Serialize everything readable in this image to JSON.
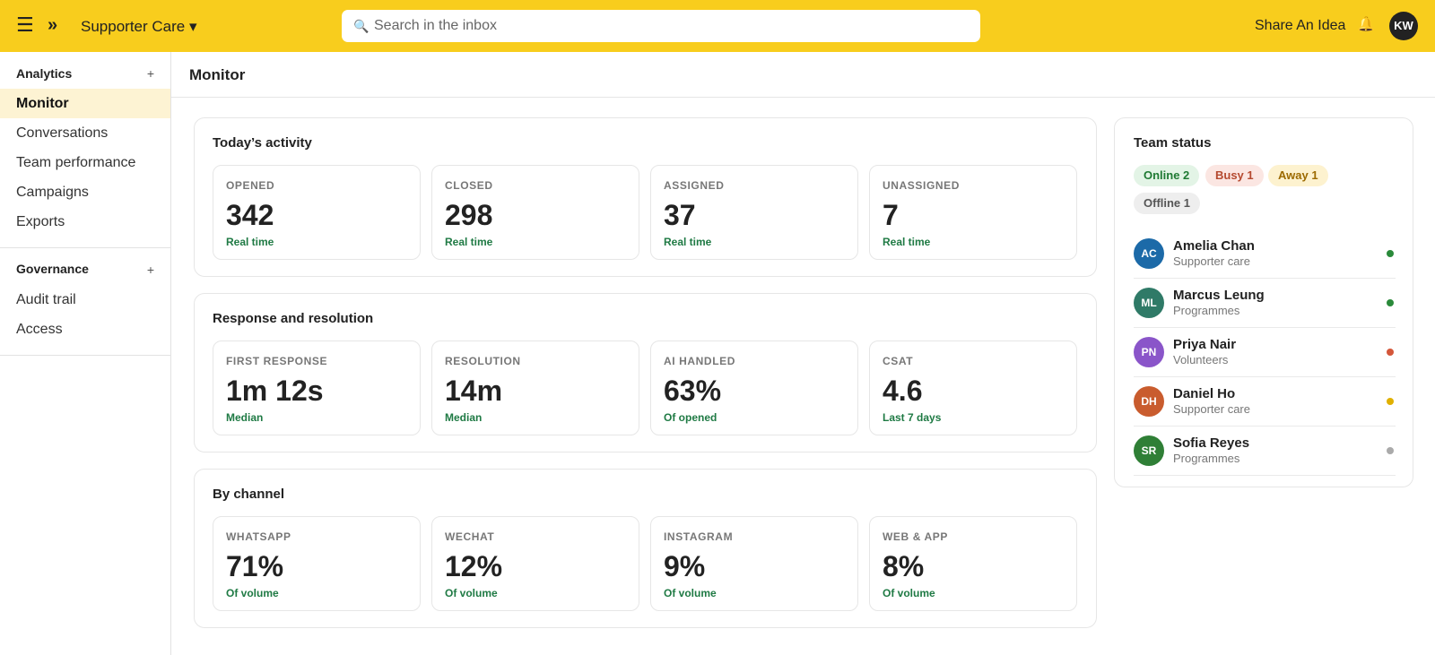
{
  "topbar": {
    "workspace": "Supporter Care ▾",
    "search_placeholder": "Search in the inbox",
    "share_label": "Share An Idea",
    "user_initials": "KW"
  },
  "sidebar": {
    "sections": [
      {
        "title": "Analytics",
        "items": [
          "Monitor",
          "Conversations",
          "Team performance",
          "Campaigns",
          "Exports"
        ]
      },
      {
        "title": "Governance",
        "items": [
          "Audit trail",
          "Access"
        ]
      }
    ],
    "active": "Monitor"
  },
  "page": {
    "title": "Monitor"
  },
  "activity": {
    "title": "Today’s activity",
    "cards": [
      {
        "label": "OPENED",
        "value": "342",
        "sub": "Real time"
      },
      {
        "label": "CLOSED",
        "value": "298",
        "sub": "Real time"
      },
      {
        "label": "ASSIGNED",
        "value": "37",
        "sub": "Real time"
      },
      {
        "label": "UNASSIGNED",
        "value": "7",
        "sub": "Real time"
      }
    ]
  },
  "response": {
    "title": "Response and resolution",
    "cards": [
      {
        "label": "FIRST RESPONSE",
        "value": "1m 12s",
        "sub": "Median"
      },
      {
        "label": "RESOLUTION",
        "value": "14m",
        "sub": "Median"
      },
      {
        "label": "AI HANDLED",
        "value": "63%",
        "sub": "Of opened"
      },
      {
        "label": "CSAT",
        "value": "4.6",
        "sub": "Last 7 days"
      }
    ]
  },
  "channels": {
    "title": "By channel",
    "cards": [
      {
        "label": "WHATSAPP",
        "value": "71%",
        "sub": "Of volume"
      },
      {
        "label": "WECHAT",
        "value": "12%",
        "sub": "Of volume"
      },
      {
        "label": "INSTAGRAM",
        "value": "9%",
        "sub": "Of volume"
      },
      {
        "label": "WEB & APP",
        "value": "8%",
        "sub": "Of volume"
      }
    ]
  },
  "team": {
    "title": "Team status",
    "chips": {
      "online": "Online 2",
      "busy": "Busy 1",
      "away": "Away 1",
      "offline": "Offline 1"
    },
    "members": [
      {
        "initials": "AC",
        "name": "Amelia Chan",
        "role": "Supporter care",
        "status": "online",
        "color": "#1c6aa8"
      },
      {
        "initials": "ML",
        "name": "Marcus Leung",
        "role": "Programmes",
        "status": "online",
        "color": "#2f7a67"
      },
      {
        "initials": "PN",
        "name": "Priya Nair",
        "role": "Volunteers",
        "status": "busy",
        "color": "#8a55c9"
      },
      {
        "initials": "DH",
        "name": "Daniel Ho",
        "role": "Supporter care",
        "status": "away",
        "color": "#c95c2e"
      },
      {
        "initials": "SR",
        "name": "Sofia Reyes",
        "role": "Programmes",
        "status": "offline",
        "color": "#2f7f36"
      }
    ],
    "status_colors": {
      "online": "#2a8a3a",
      "busy": "#d4573a",
      "away": "#e0b000",
      "offline": "#aaaaaa"
    }
  },
  "colors": {
    "brand": "#f8cd1d",
    "accent_text": "#1f7a44"
  }
}
